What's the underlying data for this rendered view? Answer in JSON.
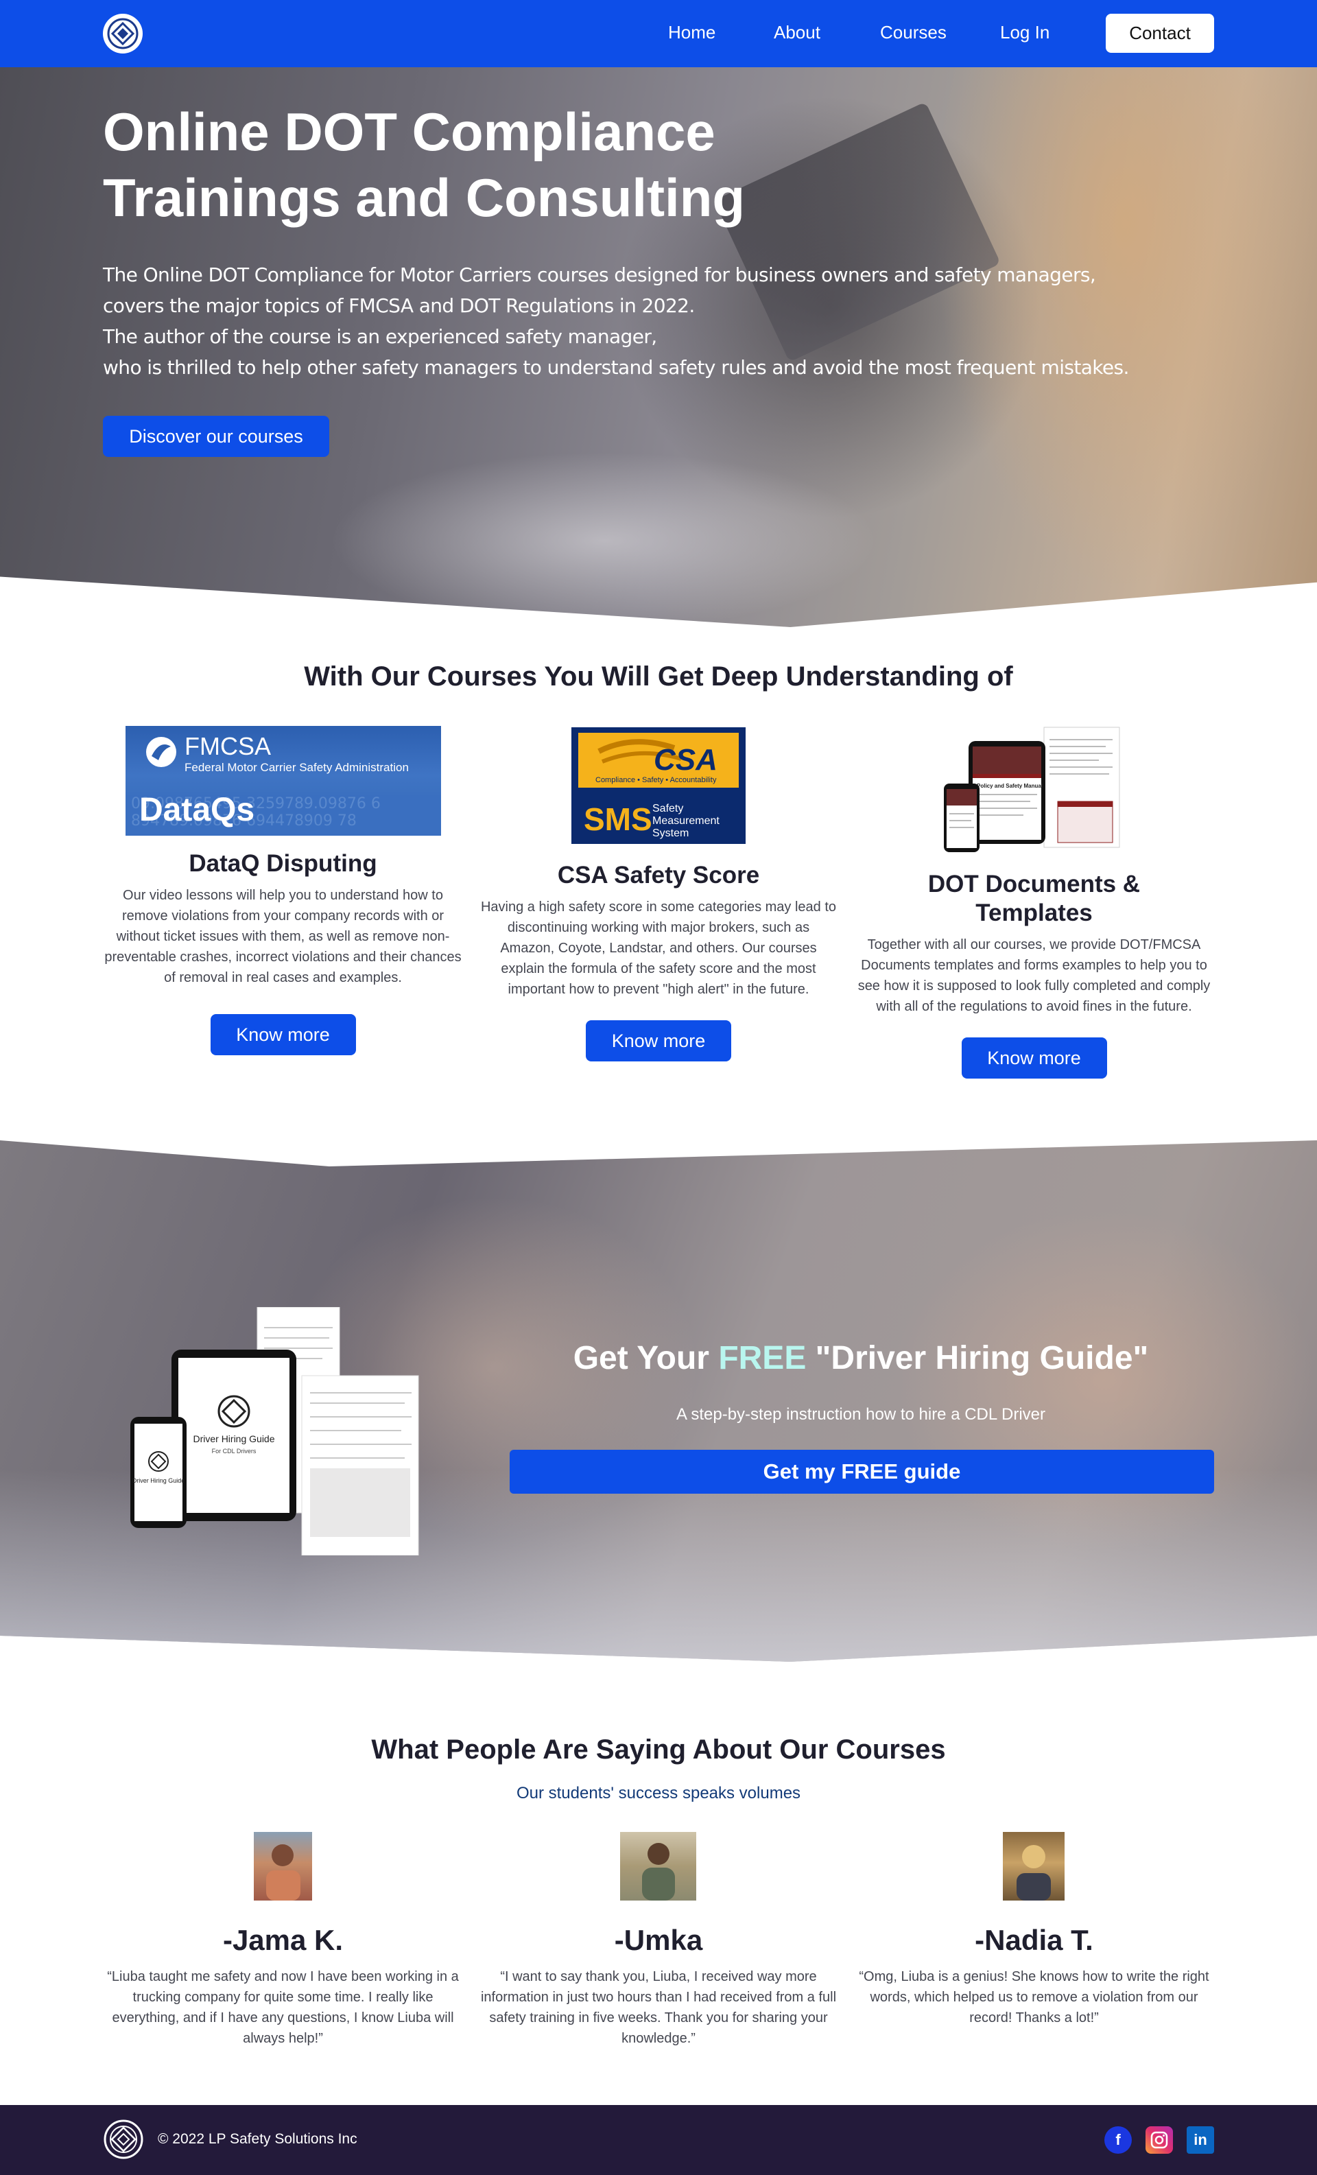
{
  "nav": {
    "links": [
      "Home",
      "About",
      "Courses",
      "Log In"
    ],
    "contact_label": "Contact"
  },
  "hero": {
    "title_line1": "Online DOT Compliance",
    "title_line2": "Trainings and Consulting",
    "desc": [
      "The Online DOT Compliance for Motor Carriers courses designed for business owners and safety managers,",
      "covers the major topics of FMCSA and DOT Regulations in 2022.",
      "The author of the course is an experienced safety manager,",
      "who is thrilled to help other safety managers to understand safety rules and avoid the most frequent mistakes."
    ],
    "button_label": "Discover our courses"
  },
  "features": {
    "title": "With Our Courses You Will Get Deep Understanding of",
    "items": [
      {
        "title": "DataQ Disputing",
        "text": "Our video lessons will help you to understand how to remove violations from your company records with or without ticket issues with them, as well as remove non-preventable crashes, incorrect violations and their chances of removal in real cases and examples.",
        "button": "Know more"
      },
      {
        "title": "CSA Safety Score",
        "text": "Having a high safety score in some categories may lead to discontinuing working with major brokers, such as Amazon, Coyote, Landstar, and others. Our courses explain the formula of the safety score and the most important how to prevent \"high alert\" in the future.",
        "button": "Know more"
      },
      {
        "title": "DOT Documents & Templates",
        "text": "Together with all our courses, we provide DOT/FMCSA Documents templates and forms examples to help you to see how it is supposed to look fully completed and comply with all of the regulations to avoid fines in the future.",
        "button": "Know more"
      }
    ],
    "images": {
      "fmcsa_name": "FMCSA",
      "fmcsa_full": "Federal Motor Carrier Safety Administration",
      "fmcsa_dataqs": "DataQs",
      "csa_logo": "CSA",
      "csa_tagline": "Compliance • Safety • Accountability",
      "sms_logo": "SMS",
      "sms_text": "Safety Measurement System",
      "doc_title": "Policy and Safety Manual"
    }
  },
  "guide": {
    "title_before": "Get Your ",
    "title_free": "FREE",
    "title_after": " \"Driver Hiring Guide\"",
    "subtitle": "A step-by-step instruction how to hire a CDL Driver",
    "button_label": "Get my FREE guide",
    "device_title": "Driver Hiring Guide",
    "device_sub": "For CDL Drivers"
  },
  "testimonials": {
    "title": "What People Are Saying About Our Courses",
    "subtitle": "Our students' success speaks volumes",
    "items": [
      {
        "name": "-Jama K.",
        "text": "“Liuba taught me safety and now I have been working in a trucking company for quite some time. I really like everything, and if I have any questions, I know Liuba will always help!”"
      },
      {
        "name": "-Umka",
        "text": "“I want to say thank you, Liuba, I received way more information in just two hours than I had received from a full safety training in five weeks. Thank you for sharing your knowledge.”"
      },
      {
        "name": "-Nadia T.",
        "text": "“Omg, Liuba is a genius! She knows how to write the right words, which helped us to remove a violation from our record! Thanks a lot!”"
      }
    ]
  },
  "footer": {
    "copyright": "© 2022 LP Safety Solutions Inc",
    "social": [
      "facebook-icon",
      "instagram-icon",
      "linkedin-icon"
    ]
  },
  "colors": {
    "brand_blue": "#0d4ee8",
    "footer_bg": "#231a3a",
    "free_accent": "#b9f6ef"
  }
}
